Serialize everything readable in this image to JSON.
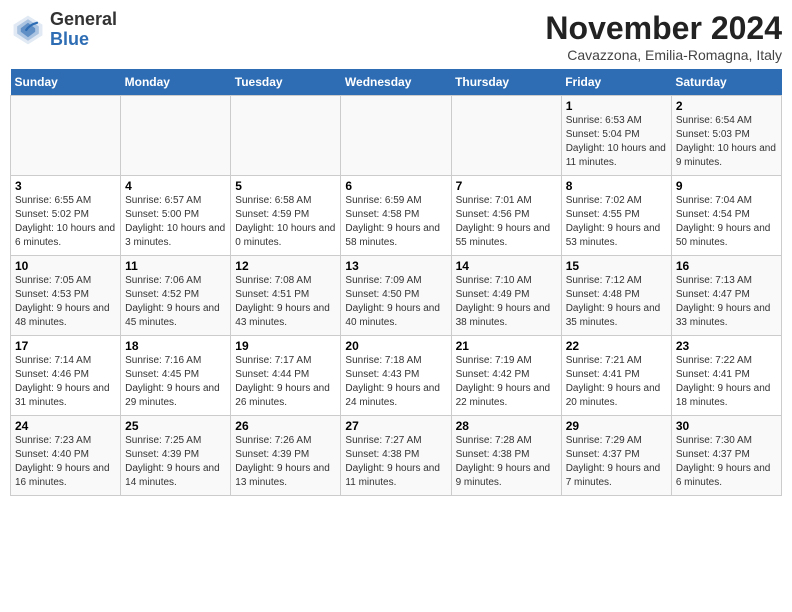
{
  "header": {
    "logo_general": "General",
    "logo_blue": "Blue",
    "month_title": "November 2024",
    "subtitle": "Cavazzona, Emilia-Romagna, Italy"
  },
  "days_of_week": [
    "Sunday",
    "Monday",
    "Tuesday",
    "Wednesday",
    "Thursday",
    "Friday",
    "Saturday"
  ],
  "weeks": [
    [
      {
        "day": "",
        "info": ""
      },
      {
        "day": "",
        "info": ""
      },
      {
        "day": "",
        "info": ""
      },
      {
        "day": "",
        "info": ""
      },
      {
        "day": "",
        "info": ""
      },
      {
        "day": "1",
        "info": "Sunrise: 6:53 AM\nSunset: 5:04 PM\nDaylight: 10 hours and 11 minutes."
      },
      {
        "day": "2",
        "info": "Sunrise: 6:54 AM\nSunset: 5:03 PM\nDaylight: 10 hours and 9 minutes."
      }
    ],
    [
      {
        "day": "3",
        "info": "Sunrise: 6:55 AM\nSunset: 5:02 PM\nDaylight: 10 hours and 6 minutes."
      },
      {
        "day": "4",
        "info": "Sunrise: 6:57 AM\nSunset: 5:00 PM\nDaylight: 10 hours and 3 minutes."
      },
      {
        "day": "5",
        "info": "Sunrise: 6:58 AM\nSunset: 4:59 PM\nDaylight: 10 hours and 0 minutes."
      },
      {
        "day": "6",
        "info": "Sunrise: 6:59 AM\nSunset: 4:58 PM\nDaylight: 9 hours and 58 minutes."
      },
      {
        "day": "7",
        "info": "Sunrise: 7:01 AM\nSunset: 4:56 PM\nDaylight: 9 hours and 55 minutes."
      },
      {
        "day": "8",
        "info": "Sunrise: 7:02 AM\nSunset: 4:55 PM\nDaylight: 9 hours and 53 minutes."
      },
      {
        "day": "9",
        "info": "Sunrise: 7:04 AM\nSunset: 4:54 PM\nDaylight: 9 hours and 50 minutes."
      }
    ],
    [
      {
        "day": "10",
        "info": "Sunrise: 7:05 AM\nSunset: 4:53 PM\nDaylight: 9 hours and 48 minutes."
      },
      {
        "day": "11",
        "info": "Sunrise: 7:06 AM\nSunset: 4:52 PM\nDaylight: 9 hours and 45 minutes."
      },
      {
        "day": "12",
        "info": "Sunrise: 7:08 AM\nSunset: 4:51 PM\nDaylight: 9 hours and 43 minutes."
      },
      {
        "day": "13",
        "info": "Sunrise: 7:09 AM\nSunset: 4:50 PM\nDaylight: 9 hours and 40 minutes."
      },
      {
        "day": "14",
        "info": "Sunrise: 7:10 AM\nSunset: 4:49 PM\nDaylight: 9 hours and 38 minutes."
      },
      {
        "day": "15",
        "info": "Sunrise: 7:12 AM\nSunset: 4:48 PM\nDaylight: 9 hours and 35 minutes."
      },
      {
        "day": "16",
        "info": "Sunrise: 7:13 AM\nSunset: 4:47 PM\nDaylight: 9 hours and 33 minutes."
      }
    ],
    [
      {
        "day": "17",
        "info": "Sunrise: 7:14 AM\nSunset: 4:46 PM\nDaylight: 9 hours and 31 minutes."
      },
      {
        "day": "18",
        "info": "Sunrise: 7:16 AM\nSunset: 4:45 PM\nDaylight: 9 hours and 29 minutes."
      },
      {
        "day": "19",
        "info": "Sunrise: 7:17 AM\nSunset: 4:44 PM\nDaylight: 9 hours and 26 minutes."
      },
      {
        "day": "20",
        "info": "Sunrise: 7:18 AM\nSunset: 4:43 PM\nDaylight: 9 hours and 24 minutes."
      },
      {
        "day": "21",
        "info": "Sunrise: 7:19 AM\nSunset: 4:42 PM\nDaylight: 9 hours and 22 minutes."
      },
      {
        "day": "22",
        "info": "Sunrise: 7:21 AM\nSunset: 4:41 PM\nDaylight: 9 hours and 20 minutes."
      },
      {
        "day": "23",
        "info": "Sunrise: 7:22 AM\nSunset: 4:41 PM\nDaylight: 9 hours and 18 minutes."
      }
    ],
    [
      {
        "day": "24",
        "info": "Sunrise: 7:23 AM\nSunset: 4:40 PM\nDaylight: 9 hours and 16 minutes."
      },
      {
        "day": "25",
        "info": "Sunrise: 7:25 AM\nSunset: 4:39 PM\nDaylight: 9 hours and 14 minutes."
      },
      {
        "day": "26",
        "info": "Sunrise: 7:26 AM\nSunset: 4:39 PM\nDaylight: 9 hours and 13 minutes."
      },
      {
        "day": "27",
        "info": "Sunrise: 7:27 AM\nSunset: 4:38 PM\nDaylight: 9 hours and 11 minutes."
      },
      {
        "day": "28",
        "info": "Sunrise: 7:28 AM\nSunset: 4:38 PM\nDaylight: 9 hours and 9 minutes."
      },
      {
        "day": "29",
        "info": "Sunrise: 7:29 AM\nSunset: 4:37 PM\nDaylight: 9 hours and 7 minutes."
      },
      {
        "day": "30",
        "info": "Sunrise: 7:30 AM\nSunset: 4:37 PM\nDaylight: 9 hours and 6 minutes."
      }
    ]
  ]
}
